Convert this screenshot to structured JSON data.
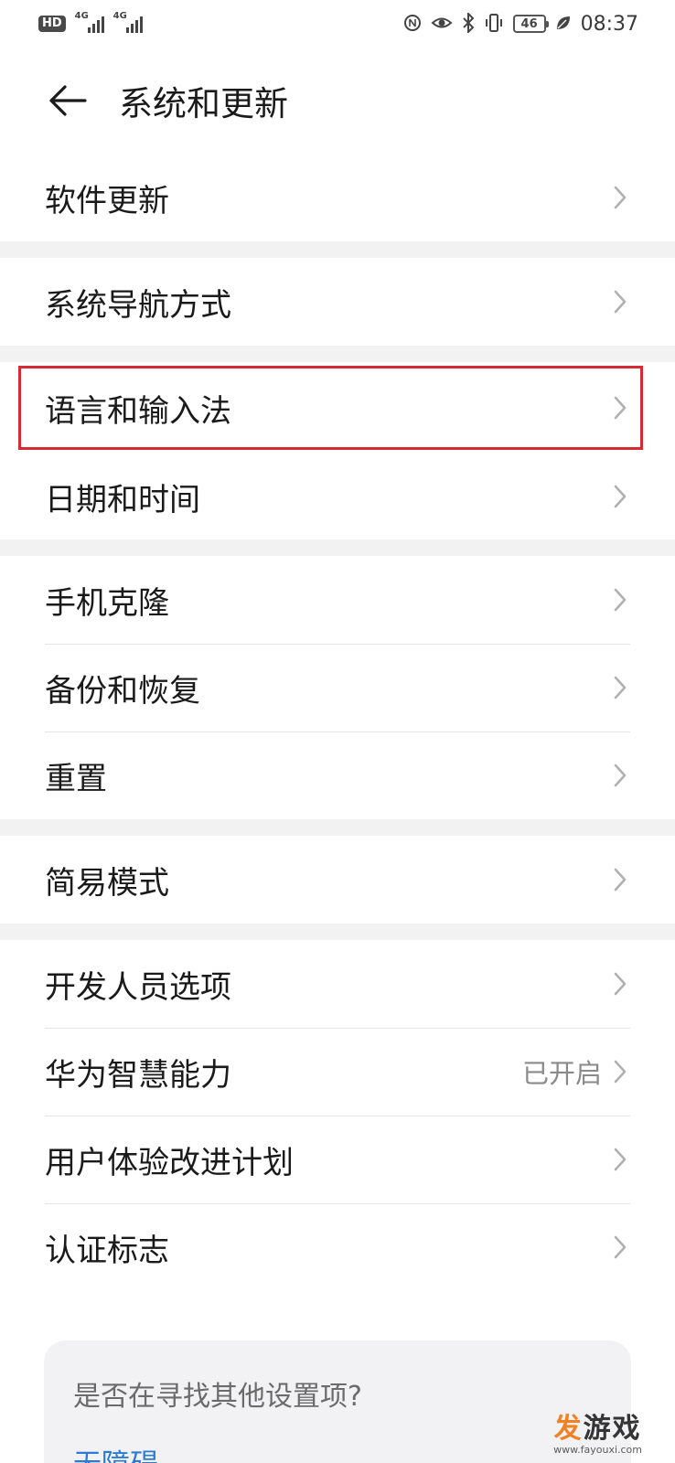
{
  "status_bar": {
    "hd": "HD",
    "sim1_net": "4G",
    "sim2_net": "4G",
    "battery": "46",
    "time": "08:37",
    "icons": [
      "nfc-icon",
      "eye-comfort-icon",
      "bluetooth-icon",
      "vibrate-icon",
      "leaf-icon"
    ]
  },
  "header": {
    "title": "系统和更新",
    "back_icon": "back-arrow-icon"
  },
  "groups": [
    {
      "items": [
        {
          "label": "软件更新"
        }
      ]
    },
    {
      "items": [
        {
          "label": "系统导航方式"
        }
      ]
    },
    {
      "items": [
        {
          "label": "语言和输入法",
          "highlighted": true
        },
        {
          "label": "日期和时间"
        }
      ]
    },
    {
      "items": [
        {
          "label": "手机克隆"
        },
        {
          "label": "备份和恢复"
        },
        {
          "label": "重置"
        }
      ]
    },
    {
      "items": [
        {
          "label": "简易模式"
        }
      ]
    },
    {
      "items": [
        {
          "label": "开发人员选项"
        },
        {
          "label": "华为智慧能力",
          "value": "已开启"
        },
        {
          "label": "用户体验改进计划"
        },
        {
          "label": "认证标志"
        }
      ]
    }
  ],
  "suggestion": {
    "title": "是否在寻找其他设置项?",
    "link": "无障碍"
  },
  "watermark": {
    "main": "发游戏",
    "sub": "www.fayouxi.com"
  },
  "colors": {
    "highlight": "#d62a35",
    "link": "#2b7ad8",
    "divider": "#e4e4e4",
    "section_gap": "#f2f2f2"
  }
}
